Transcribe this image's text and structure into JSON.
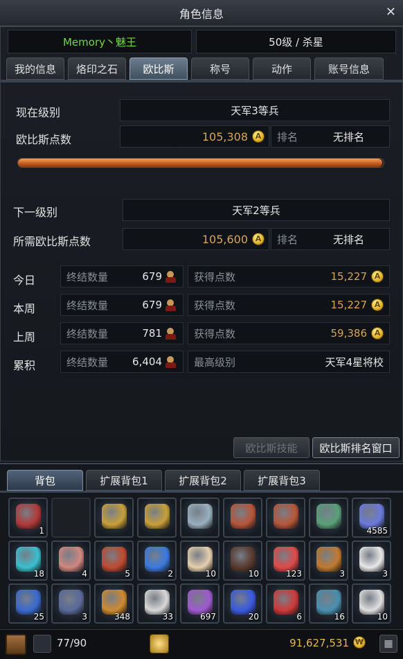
{
  "window": {
    "title": "角色信息",
    "close": "✕"
  },
  "character": {
    "name": "Memory丶魅王",
    "level_class": "50级 / 杀星"
  },
  "tabs": [
    "我的信息",
    "烙印之石",
    "欧比斯",
    "称号",
    "动作",
    "账号信息"
  ],
  "active_tab": "欧比斯",
  "current": {
    "level_label": "现在级别",
    "level_value": "天军3等兵",
    "points_label": "欧比斯点数",
    "points_value": "105,308",
    "rank_label": "排名",
    "rank_value": "无排名",
    "progress": 0.997
  },
  "next": {
    "level_label": "下一级别",
    "level_value": "天军2等兵",
    "points_label": "所需欧比斯点数",
    "points_value": "105,600",
    "rank_label": "排名",
    "rank_value": "无排名"
  },
  "stats": [
    {
      "period": "今日",
      "kill_label": "终结数量",
      "kills": "679",
      "pts_label": "获得点数",
      "pts": "15,227"
    },
    {
      "period": "本周",
      "kill_label": "终结数量",
      "kills": "679",
      "pts_label": "获得点数",
      "pts": "15,227"
    },
    {
      "period": "上周",
      "kill_label": "终结数量",
      "kills": "781",
      "pts_label": "获得点数",
      "pts": "59,386"
    },
    {
      "period": "累积",
      "kill_label": "终结数量",
      "kills": "6,404",
      "pts_label": "最高级别",
      "pts": "天军4星将校"
    }
  ],
  "buttons": {
    "skill": "欧比斯技能",
    "ranking": "欧比斯排名窗口"
  },
  "inventory": {
    "tabs": [
      "背包",
      "扩展背包1",
      "扩展背包2",
      "扩展背包3"
    ],
    "slots": [
      {
        "icon": "red-flower-icon",
        "qty": "1",
        "color": "#b23a3a"
      },
      {
        "icon": "empty-slot",
        "qty": "",
        "color": ""
      },
      {
        "icon": "gold-armor-icon",
        "qty": "",
        "color": "#c9a03a"
      },
      {
        "icon": "gold-armor-icon",
        "qty": "",
        "color": "#c9a03a"
      },
      {
        "icon": "necklace-icon",
        "qty": "",
        "color": "#9ab0c0"
      },
      {
        "icon": "red-bracelet-icon",
        "qty": "",
        "color": "#b8563a"
      },
      {
        "icon": "red-bracelet-icon",
        "qty": "",
        "color": "#b8563a"
      },
      {
        "icon": "green-belt-icon",
        "qty": "",
        "color": "#5aa07a"
      },
      {
        "icon": "blue-crystal-icon",
        "qty": "4585",
        "color": "#6a7adc"
      },
      {
        "icon": "cyan-flame-icon",
        "qty": "18",
        "color": "#3ac0d0"
      },
      {
        "icon": "meat-icon",
        "qty": "4",
        "color": "#d08880"
      },
      {
        "icon": "sausage-icon",
        "qty": "5",
        "color": "#c04a30"
      },
      {
        "icon": "blue-orb-icon",
        "qty": "2",
        "color": "#3a7ae0"
      },
      {
        "icon": "bread-icon",
        "qty": "10",
        "color": "#e6cfae"
      },
      {
        "icon": "chocolate-icon",
        "qty": "10",
        "color": "#5a3a30"
      },
      {
        "icon": "jelly-icon",
        "qty": "123",
        "color": "#e04a4a"
      },
      {
        "icon": "basket-icon",
        "qty": "3",
        "color": "#c07a30"
      },
      {
        "icon": "polar-bear-icon",
        "qty": "3",
        "color": "#e8e8e8"
      },
      {
        "icon": "blue-dragon-icon",
        "qty": "25",
        "color": "#3a6ad0"
      },
      {
        "icon": "dark-crystal-icon",
        "qty": "3",
        "color": "#5a6a9a"
      },
      {
        "icon": "orange-potion-icon",
        "qty": "348",
        "color": "#d08a30"
      },
      {
        "icon": "white-potion-icon",
        "qty": "33",
        "color": "#d8d8d8"
      },
      {
        "icon": "purple-potion-icon",
        "qty": "697",
        "color": "#a05ad0"
      },
      {
        "icon": "blue-potion-icon",
        "qty": "20",
        "color": "#3a5ae0"
      },
      {
        "icon": "red-potion-icon",
        "qty": "6",
        "color": "#d03a3a"
      },
      {
        "icon": "teal-potion-icon",
        "qty": "16",
        "color": "#4a90b0"
      },
      {
        "icon": "white-potion-icon",
        "qty": "10",
        "color": "#e0e0e0"
      }
    ],
    "capacity": "77/90",
    "money": "91,627,531"
  }
}
